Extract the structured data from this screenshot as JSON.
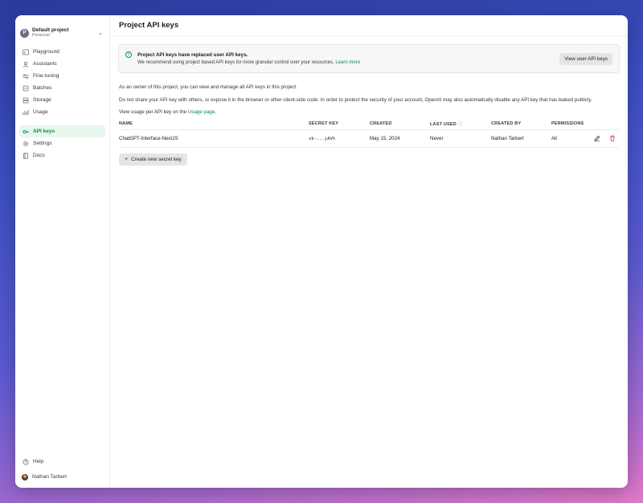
{
  "project": {
    "avatar_letter": "P",
    "name": "Default project",
    "subtitle": "Personal"
  },
  "sidebar": {
    "groups": [
      [
        {
          "label": "Playground",
          "icon": "playground-icon"
        },
        {
          "label": "Assistants",
          "icon": "assistants-icon"
        },
        {
          "label": "Fine-tuning",
          "icon": "fine-tuning-icon"
        },
        {
          "label": "Batches",
          "icon": "batches-icon"
        },
        {
          "label": "Storage",
          "icon": "storage-icon"
        },
        {
          "label": "Usage",
          "icon": "usage-icon"
        }
      ],
      [
        {
          "label": "API keys",
          "icon": "key-icon",
          "active": true
        },
        {
          "label": "Settings",
          "icon": "gear-icon"
        },
        {
          "label": "Docs",
          "icon": "docs-icon"
        }
      ]
    ],
    "help_label": "Help",
    "user_name": "Nathan Tarbert"
  },
  "page": {
    "title": "Project API keys",
    "banner": {
      "title": "Project API keys have replaced user API keys.",
      "body": "We recommend using project based API keys for more granular control over your resources.",
      "link": "Learn more",
      "button": "View user API keys"
    },
    "desc": {
      "line1": "As an owner of this project, you can view and manage all API keys in this project.",
      "line2": "Do not share your API key with others, or expose it in the browser or other client-side code. In order to protect the security of your account, OpenAI may also automatically disable any API key that has leaked publicly.",
      "line3_prefix": "View usage per API key on the",
      "line3_link": "Usage page",
      "line3_suffix": "."
    },
    "table": {
      "headers": [
        "NAME",
        "SECRET KEY",
        "CREATED",
        "LAST USED",
        "CREATED BY",
        "PERMISSIONS"
      ],
      "rows": [
        {
          "name": "ChatGPT-Interface-NextJS",
          "secret": "sk-...jAVh",
          "created": "May 15, 2024",
          "last_used": "Never",
          "created_by": "Nathan Tarbert",
          "permissions": "All"
        }
      ]
    },
    "create_button": "Create new secret key"
  },
  "colors": {
    "accent": "#0e8a4d",
    "danger": "#d43b3b"
  }
}
